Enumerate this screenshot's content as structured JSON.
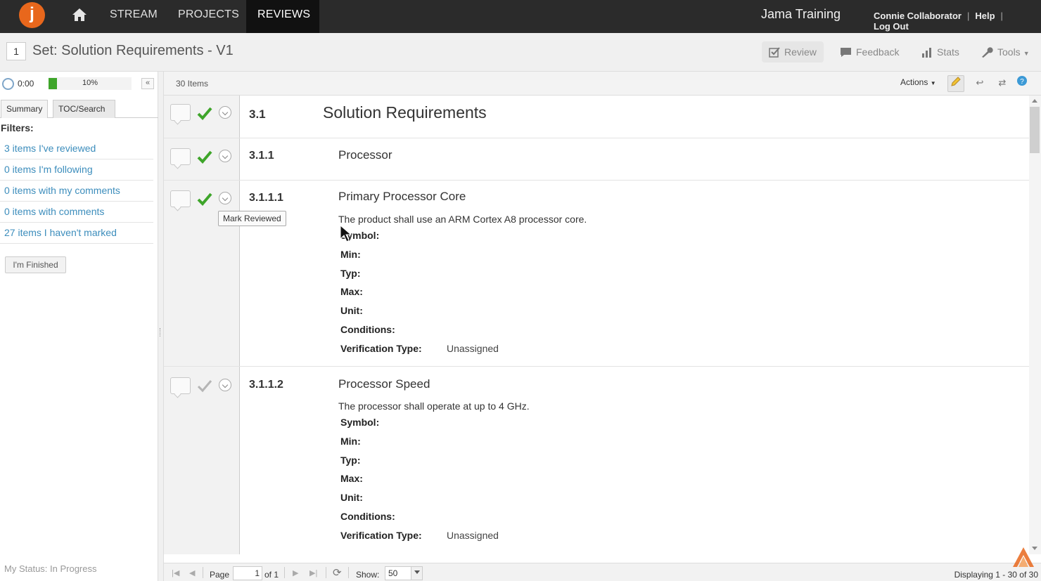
{
  "nav": {
    "logo_letter": "j",
    "items": [
      "STREAM",
      "PROJECTS",
      "REVIEWS"
    ],
    "active": "REVIEWS",
    "brand": "Jama Training",
    "user": "Connie Collaborator",
    "help": "Help",
    "logout": "Log Out"
  },
  "header": {
    "set_number": "1",
    "title": "Set: Solution Requirements - V1",
    "tools": {
      "review": "Review",
      "feedback": "Feedback",
      "stats": "Stats",
      "tools": "Tools"
    }
  },
  "left": {
    "timer": "0:00",
    "progress_label": "10%",
    "progress_value": 0.1,
    "tabs": [
      "Summary",
      "TOC/Search"
    ],
    "filters_label": "Filters:",
    "filters": [
      "3 items I've reviewed",
      "0 items I'm following",
      "0 items with my comments",
      "0 items with comments",
      "27 items I haven't marked"
    ],
    "finished_button": "I'm Finished",
    "status": "My Status: In Progress"
  },
  "main": {
    "items_count": "30 Items",
    "actions": "Actions",
    "tooltip": "Mark Reviewed",
    "items": [
      {
        "num": "3.1",
        "name": "Solution Requirements"
      },
      {
        "num": "3.1.1",
        "name": "Processor"
      },
      {
        "num": "3.1.1.1",
        "name": "Primary Processor Core",
        "desc": "The product shall use an ARM Cortex A8 processor core."
      },
      {
        "num": "3.1.1.2",
        "name": "Processor Speed",
        "desc": "The processor shall operate at up to 4 GHz."
      }
    ],
    "fields": {
      "symbol": "Symbol:",
      "min": "Min:",
      "typ": "Typ:",
      "max": "Max:",
      "unit": "Unit:",
      "conditions": "Conditions:",
      "verification": "Verification Type:",
      "verification_value": "Unassigned"
    }
  },
  "pager": {
    "page_label": "Page",
    "page_value": "1",
    "of_label": "of 1",
    "show_label": "Show:",
    "show_value": "50",
    "displaying": "Displaying 1 - 30 of 30"
  },
  "colors": {
    "accent_orange": "#e8671c",
    "check_green": "#3ea52a",
    "link_blue": "#3c8dbc"
  }
}
